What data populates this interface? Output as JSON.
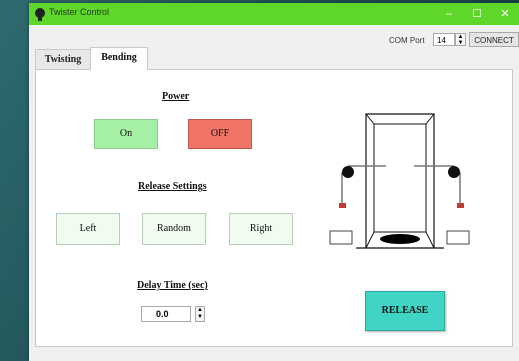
{
  "window": {
    "title": "Twister Control",
    "minimize_symbol": "–",
    "maximize_symbol": "☐",
    "close_symbol": "✕"
  },
  "toolbar": {
    "com_label": "COM Port",
    "com_value": "14",
    "spin_up": "▲",
    "spin_down": "▼",
    "connect_label": "CONNECT"
  },
  "tabs": [
    {
      "label": "Twisting"
    },
    {
      "label": "Bending",
      "selected": true
    }
  ],
  "bending": {
    "power": {
      "heading": "Power",
      "on_label": "On",
      "off_label": "OFF"
    },
    "release_settings": {
      "heading": "Release Settings",
      "left_label": "Left",
      "random_label": "Random",
      "right_label": "Right"
    },
    "delay": {
      "heading": "Delay Time (sec)",
      "value": "0.0"
    },
    "release_label": "RELEASE"
  },
  "colors": {
    "titlebar": "#5ed62a",
    "on": "#a5f0a5",
    "off": "#f07468",
    "release": "#3fd4c4",
    "direction": "#effcef"
  }
}
